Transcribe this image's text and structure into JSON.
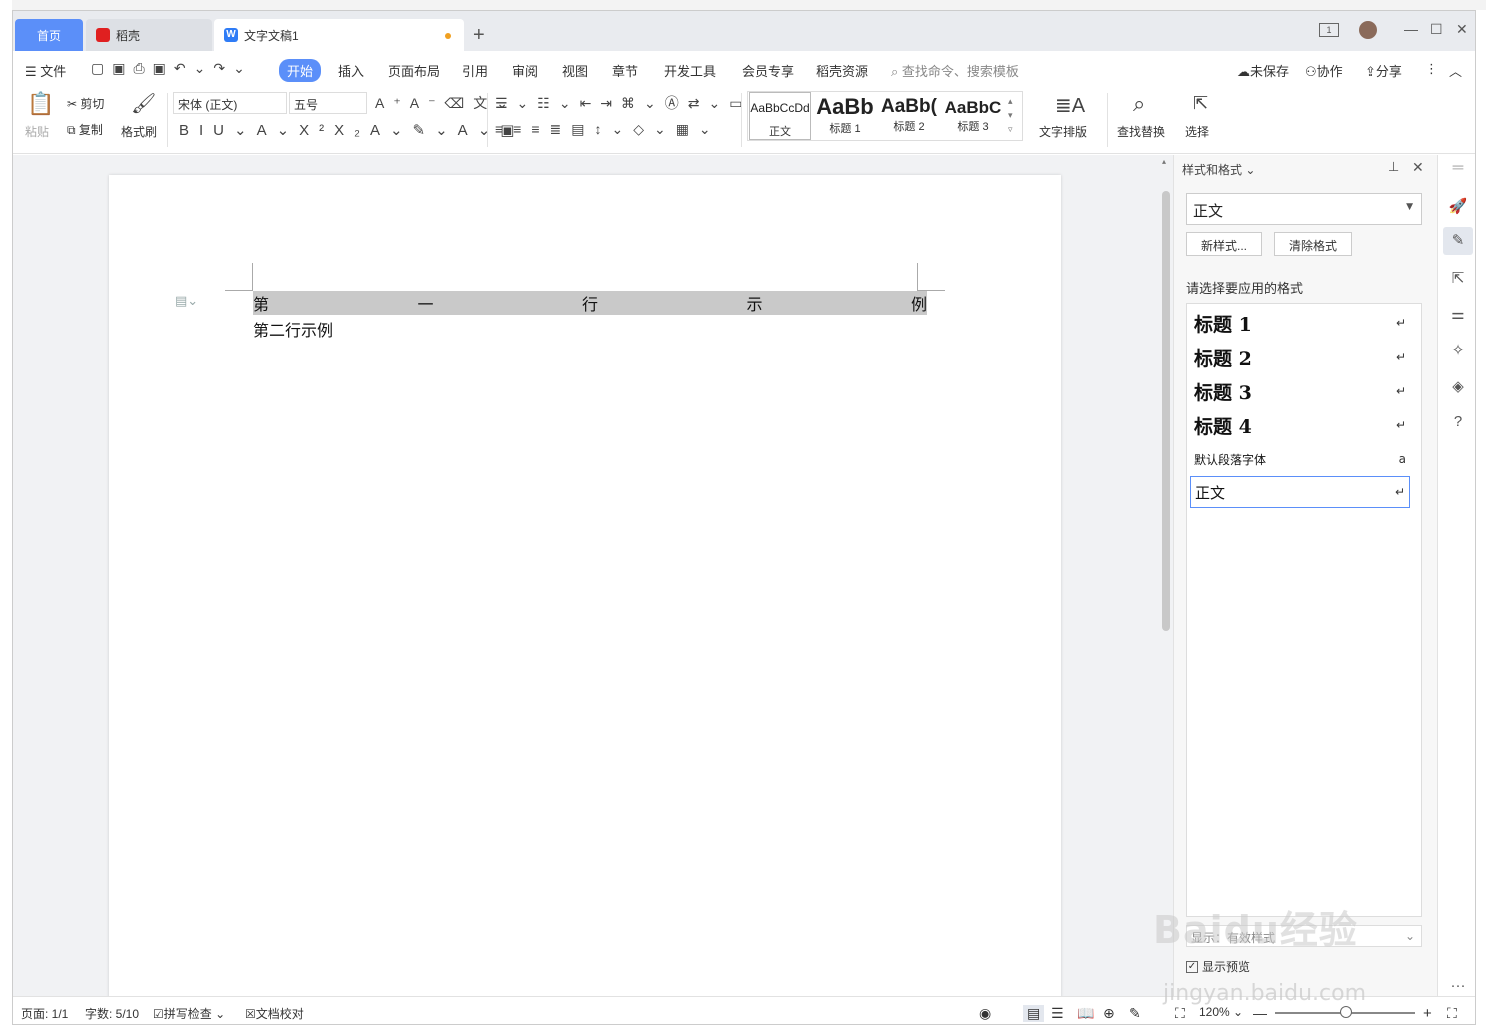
{
  "tabs": {
    "home": "首页",
    "daoke": "稻壳",
    "doc": "文字文稿1",
    "new_tab": "+"
  },
  "menu": {
    "file": "文件",
    "items": [
      "开始",
      "插入",
      "页面布局",
      "引用",
      "审阅",
      "视图",
      "章节",
      "开发工具",
      "会员专享",
      "稻壳资源"
    ],
    "search_placeholder": "查找命令、搜索模板",
    "unsaved": "未保存",
    "collab": "协作",
    "share": "分享"
  },
  "ribbon": {
    "paste": "粘贴",
    "cut": "剪切",
    "copy": "复制",
    "format_painter": "格式刷",
    "font_name": "宋体 (正文)",
    "font_size": "五号",
    "styles": [
      {
        "preview": "AaBbCcDd",
        "label": "正文"
      },
      {
        "preview": "AaBb",
        "label": "标题 1"
      },
      {
        "preview": "AaBb(",
        "label": "标题 2"
      },
      {
        "preview": "AaBbC",
        "label": "标题 3"
      }
    ],
    "text_layout": "文字排版",
    "find_replace": "查找替换",
    "select": "选择"
  },
  "document": {
    "line1_chars": [
      "第",
      "一",
      "行",
      "示",
      "例"
    ],
    "line2": "第二行示例"
  },
  "pane": {
    "title": "样式和格式",
    "current_style": "正文",
    "new_style": "新样式...",
    "clear_format": "清除格式",
    "subtitle": "请选择要应用的格式",
    "styles": [
      {
        "name": "标题  1",
        "mark": "↵"
      },
      {
        "name": "标题  2",
        "mark": "↵"
      },
      {
        "name": "标题  3",
        "mark": "↵"
      },
      {
        "name": "标题  4",
        "mark": "↵"
      },
      {
        "name": "默认段落字体",
        "mark": "a"
      },
      {
        "name": "正文",
        "mark": "↵"
      }
    ],
    "show_label": "显示：有效样式",
    "show_preview": "显示预览"
  },
  "status": {
    "page": "页面: 1/1",
    "words": "字数: 5/10",
    "spell": "拼写检查",
    "proof": "文档校对",
    "zoom": "120%"
  },
  "watermark": {
    "brand": "Baidu经验",
    "url": "jingyan.baidu.com"
  },
  "colors": {
    "accent": "#5b8ff9",
    "selection": "#c9c9c9"
  }
}
